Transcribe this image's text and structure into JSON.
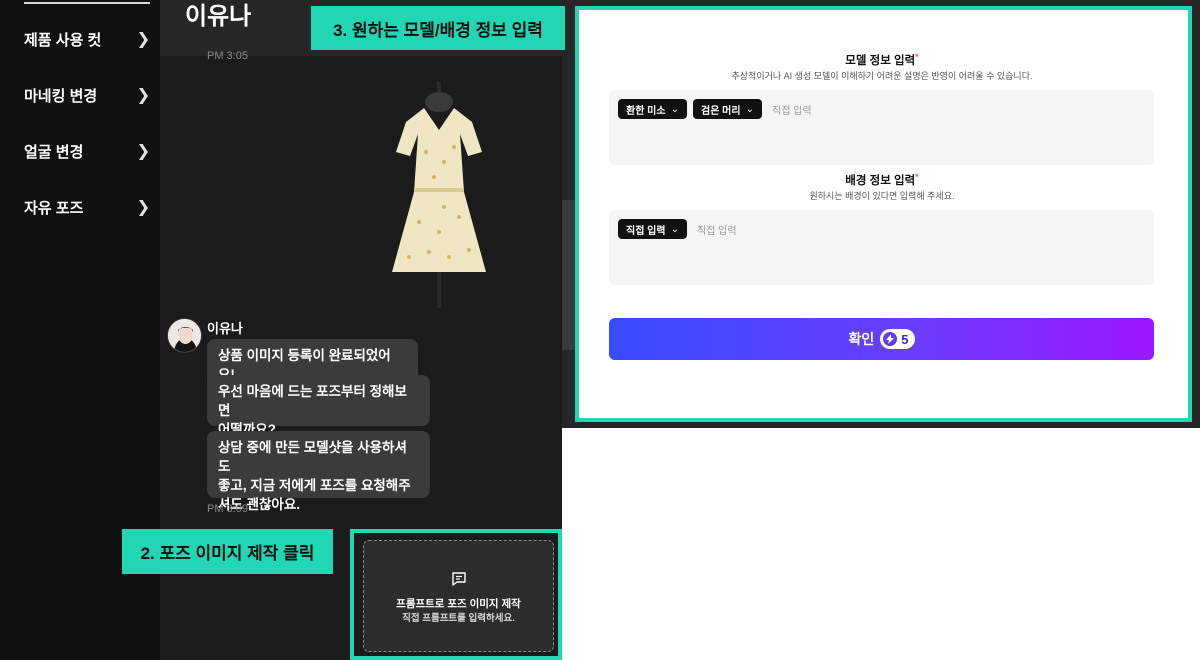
{
  "sidebar": {
    "items": [
      {
        "label": "제품 사용 컷"
      },
      {
        "label": "마네킹 변경"
      },
      {
        "label": "얼굴 변경"
      },
      {
        "label": "자유 포즈"
      }
    ]
  },
  "chat": {
    "title": "이유나",
    "time_top": "PM 3:05",
    "sender": "이유나",
    "messages": [
      {
        "line1": "상품 이미지 등록이 완료되었어요!",
        "line2": ""
      },
      {
        "line1": "우선 마음에 드는 포즈부터 정해보면",
        "line2": "어떨까요?"
      },
      {
        "line1": "상담 중에 만든 모델샷을 사용하셔도",
        "line2": "좋고, 지금 저에게 포즈를 요청해주",
        "line3": "셔도 괜찮아요."
      }
    ],
    "time_bottom": "PM 3:09",
    "card": {
      "icon": "message-square-icon",
      "title": "프롬프트로 포즈 이미지 제작",
      "subtitle": "직접 프롬프트를 입력하세요."
    }
  },
  "callouts": {
    "step2": "2. 포즈 이미지 제작 클릭",
    "step3": "3. 원하는 모델/배경 정보 입력"
  },
  "modal": {
    "model_section": {
      "title": "모델 정보 입력",
      "required_mark": "*",
      "description": "추상적이거나 AI 생성 모델이 이해하기 어려운 설명은 반영이 어려울 수 있습니다.",
      "chips": [
        "환한 미소",
        "검은 머리"
      ],
      "placeholder": "직접 입력"
    },
    "background_section": {
      "title": "배경 정보 입력",
      "required_mark": "*",
      "description": "원하시는 배경이 있다면 입력해 주세요.",
      "chips": [
        "직접 입력"
      ],
      "placeholder": "직접 입력"
    },
    "confirm": {
      "label": "확인",
      "credits": "5"
    }
  },
  "colors": {
    "accent": "#21d6b3",
    "gradient_start": "#3a4bff",
    "gradient_end": "#9b16ff"
  }
}
